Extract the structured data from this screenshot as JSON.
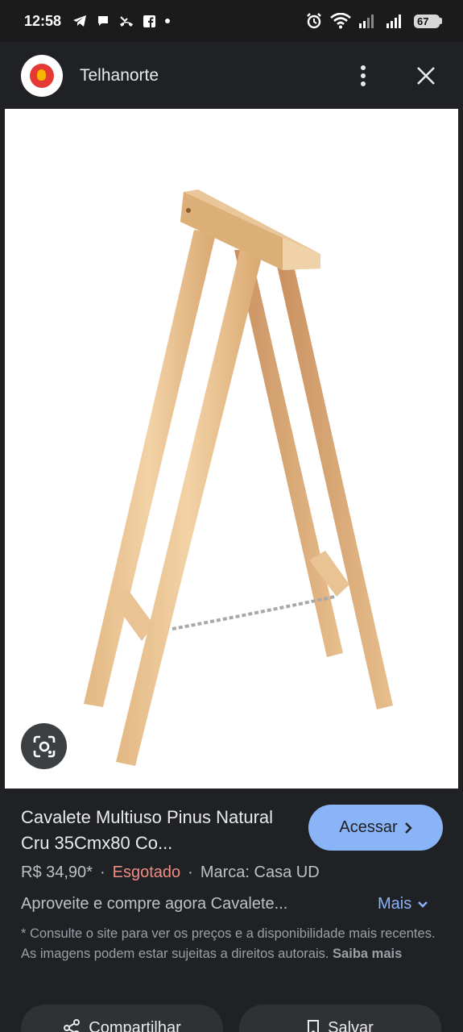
{
  "status_bar": {
    "time": "12:58",
    "battery": "67",
    "left_icons": [
      "telegram-icon",
      "chat-icon",
      "missed-call-icon",
      "facebook-icon",
      "dot-icon"
    ],
    "right_icons": [
      "alarm-icon",
      "wifi-icon",
      "signal-icon",
      "signal-icon",
      "battery-icon"
    ]
  },
  "header": {
    "site_name": "Telhanorte",
    "menu_icon": "more-vert-icon",
    "close_icon": "close-icon"
  },
  "product": {
    "title": "Cavalete Multiuso Pinus Natural Cru 35Cmx80 Co...",
    "access_label": "Acessar",
    "price": "R$ 34,90*",
    "separator": "·",
    "stock": "Esgotado",
    "brand": "Marca: Casa UD",
    "description": "Aproveite e compre agora Cavalete...",
    "more_label": "Mais",
    "disclaimer": "* Consulte o site para ver os preços e a disponibilidade mais recentes. As imagens podem estar sujeitas a direitos autorais.",
    "learn_more": "Saiba mais"
  },
  "actions": {
    "share_label": "Compartilhar",
    "save_label": "Salvar"
  },
  "colors": {
    "accent": "#8ab4f8",
    "out_of_stock": "#f28b82",
    "background": "#202124"
  }
}
